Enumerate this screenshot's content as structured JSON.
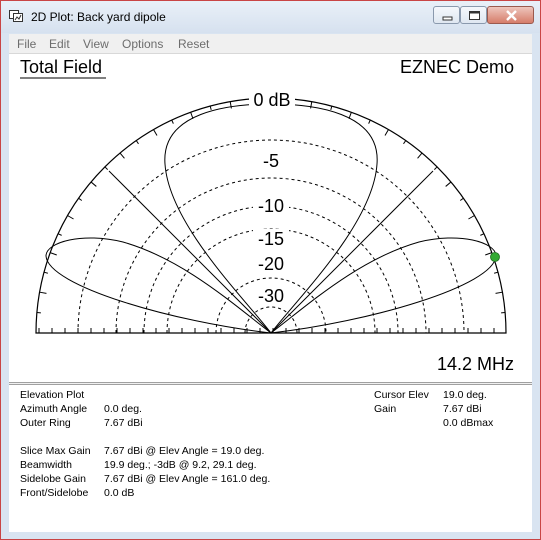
{
  "window": {
    "title": "2D Plot: Back yard dipole"
  },
  "menu": [
    "File",
    "Edit",
    "View",
    "Options",
    "Reset"
  ],
  "plot": {
    "heading": "Total Field",
    "brand": "EZNEC Demo",
    "frequency": "14.2 MHz",
    "ring_labels": [
      "0 dB",
      "-5",
      "-10",
      "-15",
      "-20",
      "-30"
    ]
  },
  "info": {
    "plot_type": "Elevation Plot",
    "azimuth_angle_label": "Azimuth Angle",
    "azimuth_angle_value": "0.0 deg.",
    "outer_ring_label": "Outer Ring",
    "outer_ring_value": "7.67 dBi",
    "slice_max_gain_label": "Slice Max Gain",
    "slice_max_gain_value": "7.67 dBi @ Elev Angle = 19.0 deg.",
    "beamwidth_label": "Beamwidth",
    "beamwidth_value": "19.9 deg.; -3dB @ 9.2, 29.1 deg.",
    "sidelobe_gain_label": "Sidelobe Gain",
    "sidelobe_gain_value": "7.67 dBi @ Elev Angle = 161.0 deg.",
    "front_sidelobe_label": "Front/Sidelobe",
    "front_sidelobe_value": "0.0 dB",
    "cursor_elev_label": "Cursor Elev",
    "cursor_elev_value": "19.0 deg.",
    "gain_label": "Gain",
    "gain_value": "7.67 dBi",
    "dbmax_value": "0.0 dBmax"
  },
  "colors": {
    "cursor": "#33aa33",
    "close_button": "#d67d6a"
  },
  "icons": [
    "app-icon",
    "minimize-icon",
    "maximize-icon",
    "close-icon"
  ]
}
